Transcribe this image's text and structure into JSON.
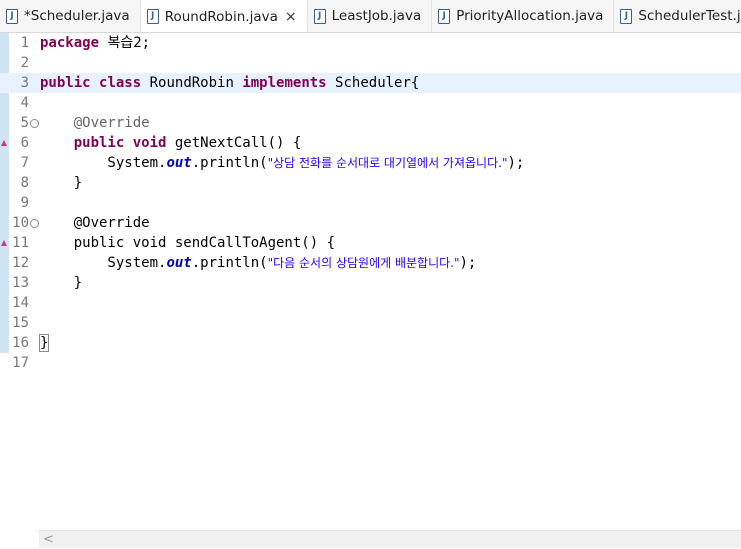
{
  "tabs": [
    {
      "label": "*Scheduler.java",
      "active": false
    },
    {
      "label": "RoundRobin.java",
      "active": true
    },
    {
      "label": "LeastJob.java",
      "active": false
    },
    {
      "label": "PriorityAllocation.java",
      "active": false
    },
    {
      "label": "SchedulerTest.java",
      "active": false
    }
  ],
  "tab_icon_letter": "J",
  "close_glyph": "×",
  "editor": {
    "current_line": 3,
    "lines": [
      [
        {
          "t": "package",
          "c": "kw"
        },
        {
          "t": " 복습2;"
        }
      ],
      [],
      [
        {
          "t": "public",
          "c": "kw"
        },
        {
          "t": " "
        },
        {
          "t": "class",
          "c": "kw"
        },
        {
          "t": " RoundRobin "
        },
        {
          "t": "implements",
          "c": "kw"
        },
        {
          "t": " Scheduler{"
        }
      ],
      [],
      [
        {
          "t": "    "
        },
        {
          "t": "@Override",
          "c": "ann"
        }
      ],
      [
        {
          "t": "    "
        },
        {
          "t": "public",
          "c": "kw"
        },
        {
          "t": " "
        },
        {
          "t": "void",
          "c": "kw"
        },
        {
          "t": " getNextCall() {"
        }
      ],
      [
        {
          "t": "        System."
        },
        {
          "t": "out",
          "c": "fld"
        },
        {
          "t": ".println("
        },
        {
          "t": "\"상담 전화를 순서대로 대기열에서 가져옵니다.\"",
          "c": "str"
        },
        {
          "t": ");"
        }
      ],
      [
        {
          "t": "    }"
        }
      ],
      [],
      [
        {
          "t": "    @Override"
        }
      ],
      [
        {
          "t": "    public void sendCallToAgent() {"
        }
      ],
      [
        {
          "t": "        System."
        },
        {
          "t": "out",
          "c": "fld"
        },
        {
          "t": ".println("
        },
        {
          "t": "\"다음 순서의 상담원에게 배분합니다.\"",
          "c": "str"
        },
        {
          "t": ");"
        }
      ],
      [
        {
          "t": "    }"
        }
      ],
      [],
      [],
      [
        {
          "t": "}",
          "c": "brace-box"
        }
      ],
      []
    ],
    "fold_lines": [
      5,
      10
    ],
    "override_lines": [
      6,
      11
    ]
  },
  "scrollbar": {
    "left_arrow": "<"
  }
}
